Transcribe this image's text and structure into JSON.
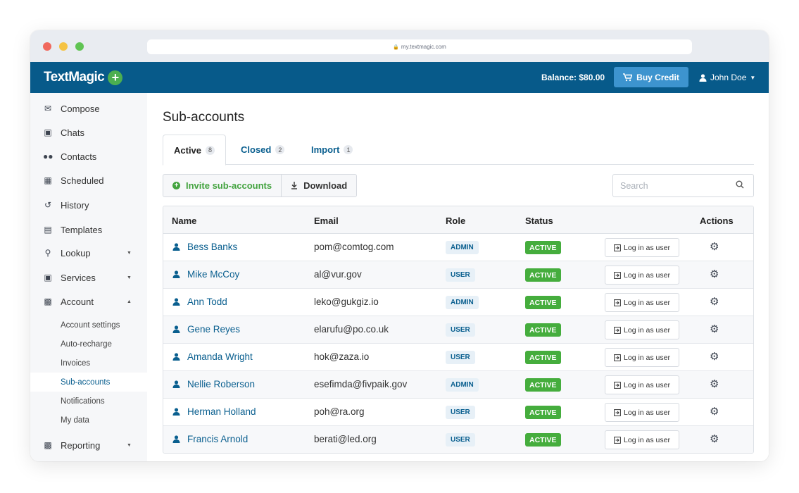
{
  "browser": {
    "url": "my.textmagic.com"
  },
  "header": {
    "logo": "TextMagic",
    "balance": "Balance: $80.00",
    "buy_credit": "Buy Credit",
    "user_name": "John Doe"
  },
  "sidebar": {
    "items": [
      {
        "label": "Compose",
        "icon": "compose-icon"
      },
      {
        "label": "Chats",
        "icon": "chat-icon"
      },
      {
        "label": "Contacts",
        "icon": "contacts-icon"
      },
      {
        "label": "Scheduled",
        "icon": "calendar-icon"
      },
      {
        "label": "History",
        "icon": "history-icon"
      },
      {
        "label": "Templates",
        "icon": "templates-icon"
      },
      {
        "label": "Lookup",
        "icon": "search-icon"
      },
      {
        "label": "Services",
        "icon": "services-icon"
      },
      {
        "label": "Account",
        "icon": "account-icon"
      }
    ],
    "account_submenu": [
      "Account settings",
      "Auto-recharge",
      "Invoices",
      "Sub-accounts",
      "Notifications",
      "My data"
    ],
    "reporting": {
      "label": "Reporting",
      "icon": "chart-icon"
    }
  },
  "main": {
    "title": "Sub-accounts",
    "tabs": [
      {
        "label": "Active",
        "count": "8"
      },
      {
        "label": "Closed",
        "count": "2"
      },
      {
        "label": "Import",
        "count": "1"
      }
    ],
    "toolbar": {
      "invite": "Invite sub-accounts",
      "download": "Download"
    },
    "search_placeholder": "Search",
    "table": {
      "columns": [
        "Name",
        "Email",
        "Role",
        "Status",
        "Actions"
      ],
      "login_label": "Log in as user",
      "rows": [
        {
          "name": "Bess Banks",
          "email": "pom@comtog.com",
          "role": "ADMIN",
          "status": "ACTIVE"
        },
        {
          "name": "Mike McCoy",
          "email": "al@vur.gov",
          "role": "USER",
          "status": "ACTIVE"
        },
        {
          "name": "Ann Todd",
          "email": "leko@gukgiz.io",
          "role": "ADMIN",
          "status": "ACTIVE"
        },
        {
          "name": "Gene Reyes",
          "email": "elarufu@po.co.uk",
          "role": "USER",
          "status": "ACTIVE"
        },
        {
          "name": "Amanda Wright",
          "email": "hok@zaza.io",
          "role": "USER",
          "status": "ACTIVE"
        },
        {
          "name": "Nellie Roberson",
          "email": "esefimda@fivpaik.gov",
          "role": "ADMIN",
          "status": "ACTIVE"
        },
        {
          "name": "Herman Holland",
          "email": "poh@ra.org",
          "role": "USER",
          "status": "ACTIVE"
        },
        {
          "name": "Francis Arnold",
          "email": "berati@led.org",
          "role": "USER",
          "status": "ACTIVE"
        }
      ]
    }
  }
}
